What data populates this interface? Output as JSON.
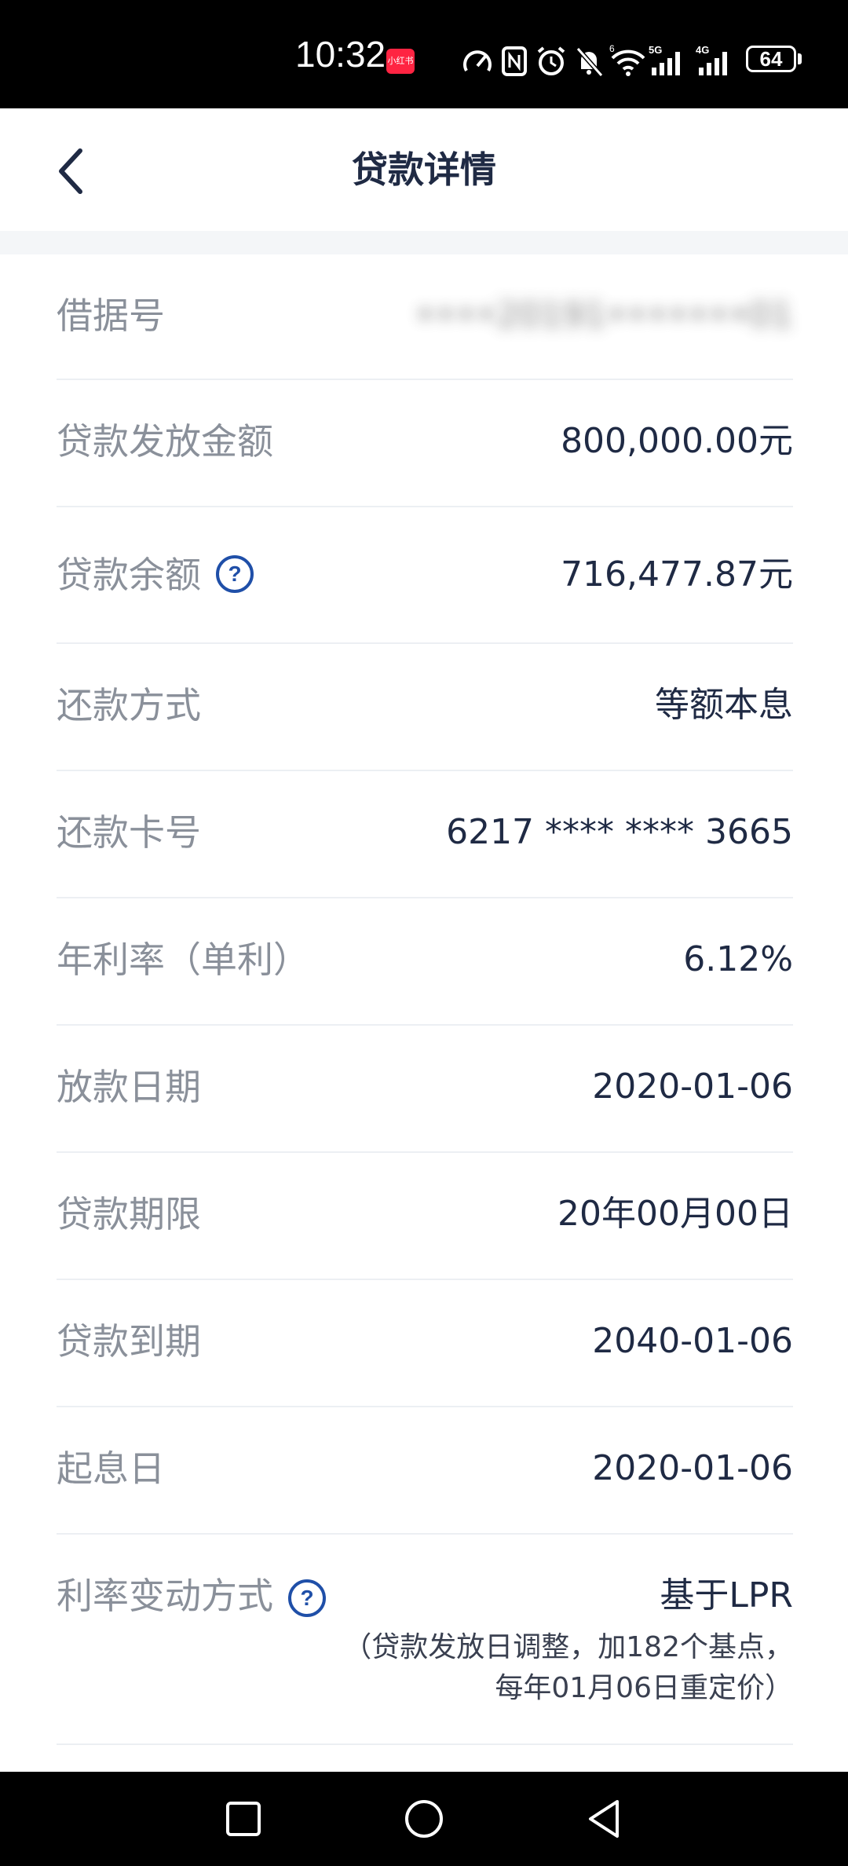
{
  "status_bar": {
    "time": "10:32",
    "app_badge": "小红书",
    "battery": "64",
    "icons": [
      "speed-icon",
      "nfc-icon",
      "alarm-icon",
      "mute-icon",
      "wifi-6-icon",
      "signal-5g-icon",
      "signal-4g-icon",
      "battery-icon"
    ]
  },
  "header": {
    "title": "贷款详情",
    "back_icon": "chevron-left-icon"
  },
  "rows": [
    {
      "label": "借据号",
      "value": "••••20191•••••••01"
    },
    {
      "label": "贷款发放金额",
      "value": "800,000.00元"
    },
    {
      "label": "贷款余额",
      "value": "716,477.87元"
    },
    {
      "label": "还款方式",
      "value": "等额本息"
    },
    {
      "label": "还款卡号",
      "value": "6217 **** **** 3665"
    },
    {
      "label": "年利率（单利）",
      "value": "6.12%"
    },
    {
      "label": "放款日期",
      "value": "2020-01-06"
    },
    {
      "label": "贷款期限",
      "value": "20年00月00日"
    },
    {
      "label": "贷款到期",
      "value": "2040-01-06"
    },
    {
      "label": "起息日",
      "value": "2020-01-06"
    },
    {
      "label": "利率变动方式",
      "value": "基于LPR",
      "note_line1": "（贷款发放日调整，加182个基点，",
      "note_line2": "每年01月06日重定价）"
    }
  ],
  "colors": {
    "accent": "#1f4fa8",
    "label": "#8a909a",
    "value": "#1f2a44"
  },
  "nav_bar": {
    "icons": [
      "recent-apps-icon",
      "home-icon",
      "back-icon"
    ]
  }
}
